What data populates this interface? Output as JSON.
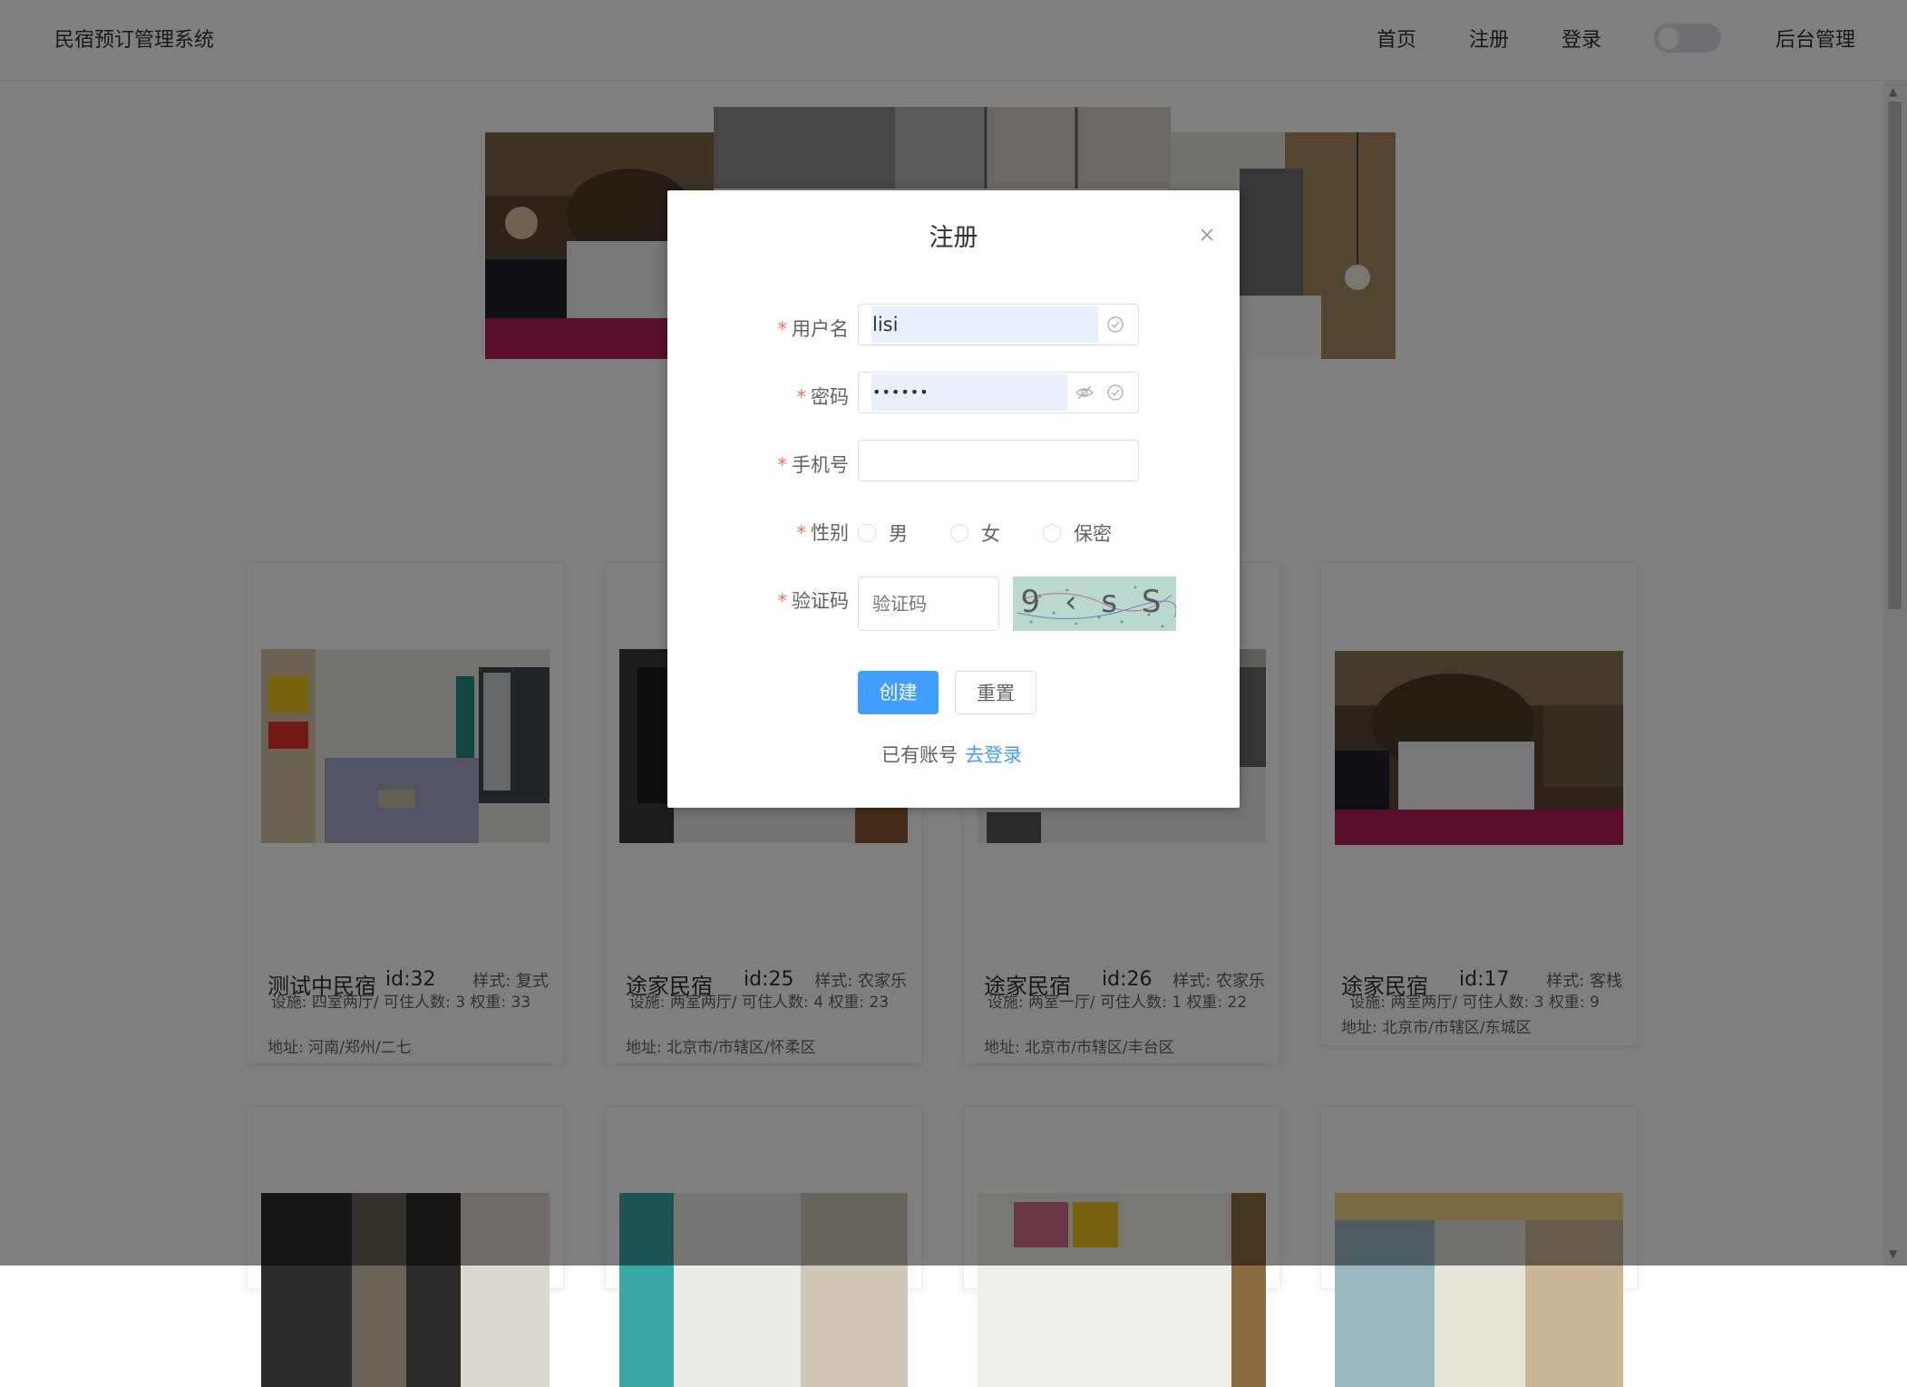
{
  "header": {
    "brand": "民宿预订管理系统",
    "nav": [
      "首页",
      "注册",
      "登录",
      "后台管理"
    ]
  },
  "cards": [
    {
      "name": "测试中民宿",
      "id": "id:32",
      "style": "样式: 复式",
      "facility": "设施: 四室两厅/ 可住人数: 3 权重: 33",
      "address": "地址: 河南/郑州/二七"
    },
    {
      "name": "途家民宿",
      "id": "id:25",
      "style": "样式: 农家乐",
      "facility": "设施: 两室两厅/ 可住人数: 4 权重: 23",
      "address": "地址: 北京市/市辖区/怀柔区"
    },
    {
      "name": "途家民宿",
      "id": "id:26",
      "style": "样式: 农家乐",
      "facility": "设施: 两室一厅/ 可住人数: 1 权重: 22",
      "address": "地址: 北京市/市辖区/丰台区"
    },
    {
      "name": "途家民宿",
      "id": "id:17",
      "style": "样式: 客栈",
      "facility": "设施: 两室两厅/ 可住人数: 3 权重: 9",
      "address": "地址: 北京市/市辖区/东城区"
    }
  ],
  "dialog": {
    "title": "注册",
    "fields": {
      "username": {
        "label": "用户名",
        "value": "lisi"
      },
      "password": {
        "label": "密码",
        "value": "••••••"
      },
      "phone": {
        "label": "手机号",
        "value": ""
      },
      "gender": {
        "label": "性别",
        "options": [
          "男",
          "女",
          "保密"
        ]
      },
      "captcha": {
        "label": "验证码",
        "placeholder": "验证码",
        "image_text": "9 ‹ s S"
      }
    },
    "buttons": {
      "create": "创建",
      "reset": "重置"
    },
    "footer": {
      "text": "已有账号",
      "link": "去登录"
    }
  },
  "colors": {
    "primary": "#409eff",
    "required": "#f56c6c",
    "autofill": "#e8f0fe",
    "overlay": "rgba(0,0,0,0.5)"
  }
}
